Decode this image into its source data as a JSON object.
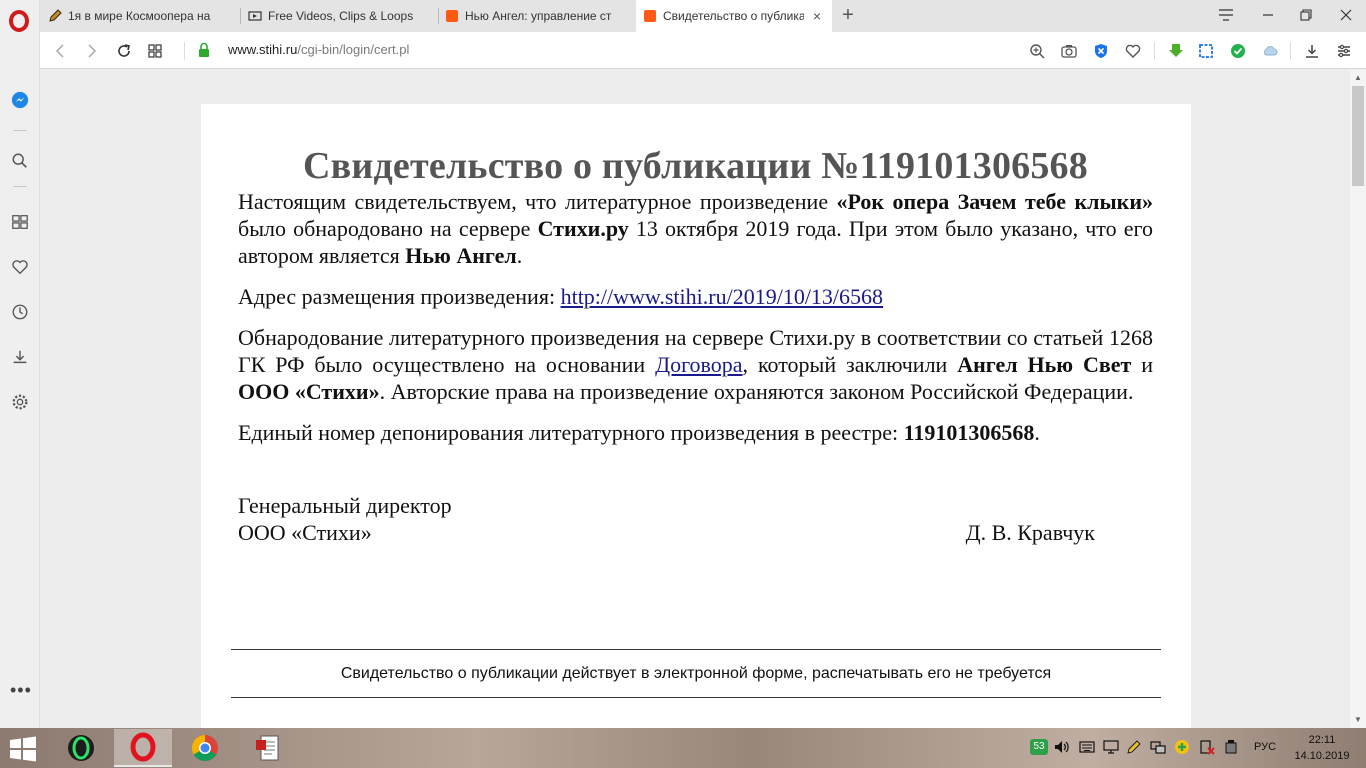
{
  "browser": {
    "tabs": [
      {
        "title": "1я в мире Космоопера на",
        "active": false
      },
      {
        "title": "Free Videos, Clips & Loops",
        "active": false
      },
      {
        "title": "Нью Ангел: управление ст",
        "active": false
      },
      {
        "title": "Свидетельство о публикац",
        "active": true
      }
    ],
    "new_tab_label": "+",
    "close_glyph": "×",
    "address": {
      "host": "www.stihi.ru",
      "path": "/cgi-bin/login/cert.pl"
    },
    "accent_color": "#d11a1a"
  },
  "document": {
    "title": "Свидетельство о публикации №119101306568",
    "p1": {
      "t1": "Настоящим свидетельствуем, что литературное произведение ",
      "work_title": "«Рок опера Зачем тебе клыки»",
      "t2": " было обнародовано на сервере ",
      "site": "Стихи.ру",
      "t3": " 13 октября 2019 года. При этом было указано, что его автором является ",
      "author": "Нью Ангел",
      "t4": "."
    },
    "p2": {
      "label": "Адрес размещения произведения: ",
      "link": "http://www.stihi.ru/2019/10/13/6568"
    },
    "p3": {
      "t1": "Обнародование литературного произведения на сервере Стихи.ру в соответствии со статьей 1268 ГК РФ было осуществлено на основании ",
      "link": "Договора",
      "t2": ", который заключили ",
      "party1": "Ангел Нью Свет",
      "t3": " и ",
      "party2": "ООО «Стихи»",
      "t4": ". Авторские права на произведение охраняются законом Российской Федерации."
    },
    "p4": {
      "label": "Единый номер депонирования литературного произведения в реестре: ",
      "number": "119101306568",
      "end": "."
    },
    "signature": {
      "position": "Генеральный директор",
      "company": "ООО «Стихи»",
      "name": "Д. В. Кравчук"
    },
    "notice": "Свидетельство о публикации действует в электронной форме, распечатывать его не требуется"
  },
  "taskbar": {
    "tray_badge": "53",
    "language": "РУС",
    "time": "22:11",
    "date": "14.10.2019"
  }
}
